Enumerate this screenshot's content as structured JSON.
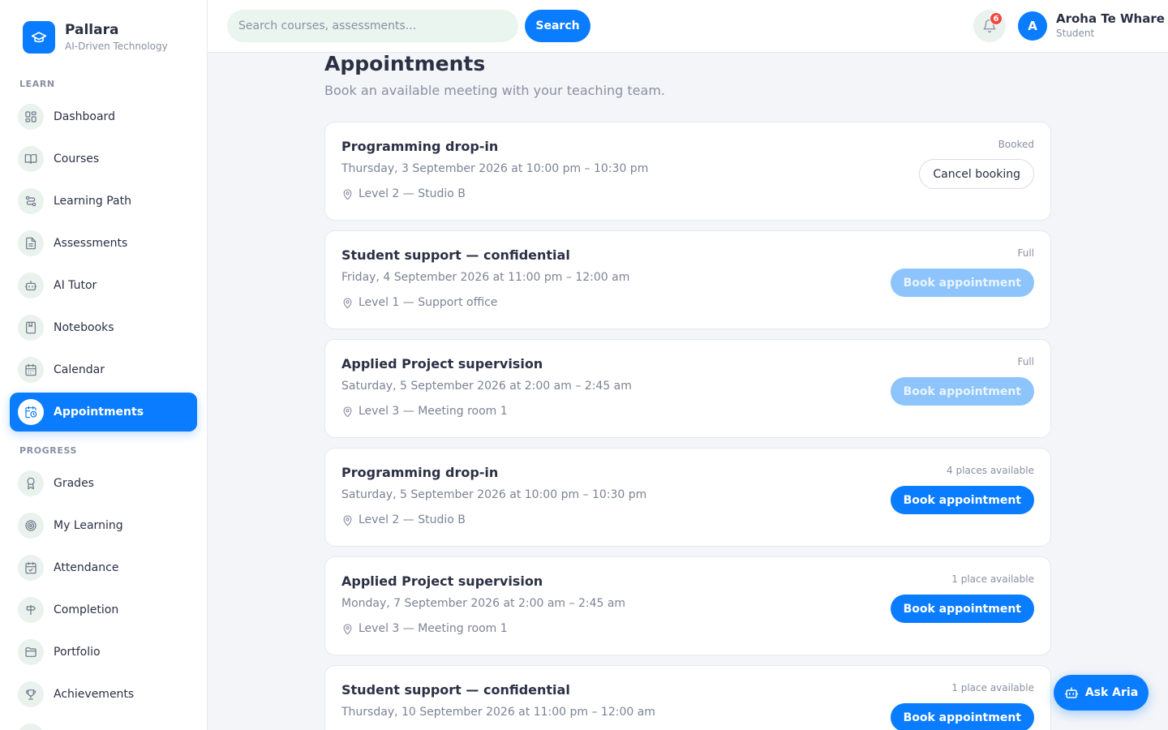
{
  "brand": {
    "name": "Pallara",
    "tagline": "AI-Driven Technology"
  },
  "sidebar": {
    "sections": [
      {
        "label": "LEARN",
        "items": [
          {
            "label": "Dashboard",
            "icon": "dashboard-icon"
          },
          {
            "label": "Courses",
            "icon": "book-icon"
          },
          {
            "label": "Learning Path",
            "icon": "route-icon"
          },
          {
            "label": "Assessments",
            "icon": "document-icon"
          },
          {
            "label": "AI Tutor",
            "icon": "robot-icon"
          },
          {
            "label": "Notebooks",
            "icon": "notebook-icon"
          },
          {
            "label": "Calendar",
            "icon": "calendar-icon"
          },
          {
            "label": "Appointments",
            "icon": "calendar-clock-icon",
            "active": true
          }
        ]
      },
      {
        "label": "PROGRESS",
        "items": [
          {
            "label": "Grades",
            "icon": "award-icon"
          },
          {
            "label": "My Learning",
            "icon": "target-icon"
          },
          {
            "label": "Attendance",
            "icon": "calendar-check-icon"
          },
          {
            "label": "Completion",
            "icon": "signpost-icon"
          },
          {
            "label": "Portfolio",
            "icon": "folder-icon"
          },
          {
            "label": "Achievements",
            "icon": "trophy-icon"
          }
        ]
      }
    ]
  },
  "topbar": {
    "search_placeholder": "Search courses, assessments...",
    "search_button": "Search",
    "notification_count": "6",
    "user": {
      "initial": "A",
      "name": "Aroha Te Whare",
      "role": "Student"
    }
  },
  "page": {
    "title": "Appointments",
    "subtitle": "Book an available meeting with your teaching team."
  },
  "appointments": [
    {
      "title": "Programming drop-in",
      "time": "Thursday, 3 September 2026 at 10:00 pm – 10:30 pm",
      "location": "Level 2 — Studio B",
      "status": "Booked",
      "action": "Cancel booking",
      "action_type": "cancel"
    },
    {
      "title": "Student support — confidential",
      "time": "Friday, 4 September 2026 at 11:00 pm – 12:00 am",
      "location": "Level 1 — Support office",
      "status": "Full",
      "action": "Book appointment",
      "action_type": "disabled"
    },
    {
      "title": "Applied Project supervision",
      "time": "Saturday, 5 September 2026 at 2:00 am – 2:45 am",
      "location": "Level 3 — Meeting room 1",
      "status": "Full",
      "action": "Book appointment",
      "action_type": "disabled"
    },
    {
      "title": "Programming drop-in",
      "time": "Saturday, 5 September 2026 at 10:00 pm – 10:30 pm",
      "location": "Level 2 — Studio B",
      "status": "4 places available",
      "action": "Book appointment",
      "action_type": "book"
    },
    {
      "title": "Applied Project supervision",
      "time": "Monday, 7 September 2026 at 2:00 am – 2:45 am",
      "location": "Level 3 — Meeting room 1",
      "status": "1 place available",
      "action": "Book appointment",
      "action_type": "book"
    },
    {
      "title": "Student support — confidential",
      "time": "Thursday, 10 September 2026 at 11:00 pm – 12:00 am",
      "location": "",
      "status": "1 place available",
      "action": "Book appointment",
      "action_type": "book"
    }
  ],
  "assistant": {
    "label": "Ask Aria",
    "icon": "robot-icon"
  },
  "colors": {
    "accent": "#0a7cff",
    "accent_disabled": "#8cc4fb",
    "badge": "#f0473d",
    "icon_bg": "#eaf2ee"
  }
}
